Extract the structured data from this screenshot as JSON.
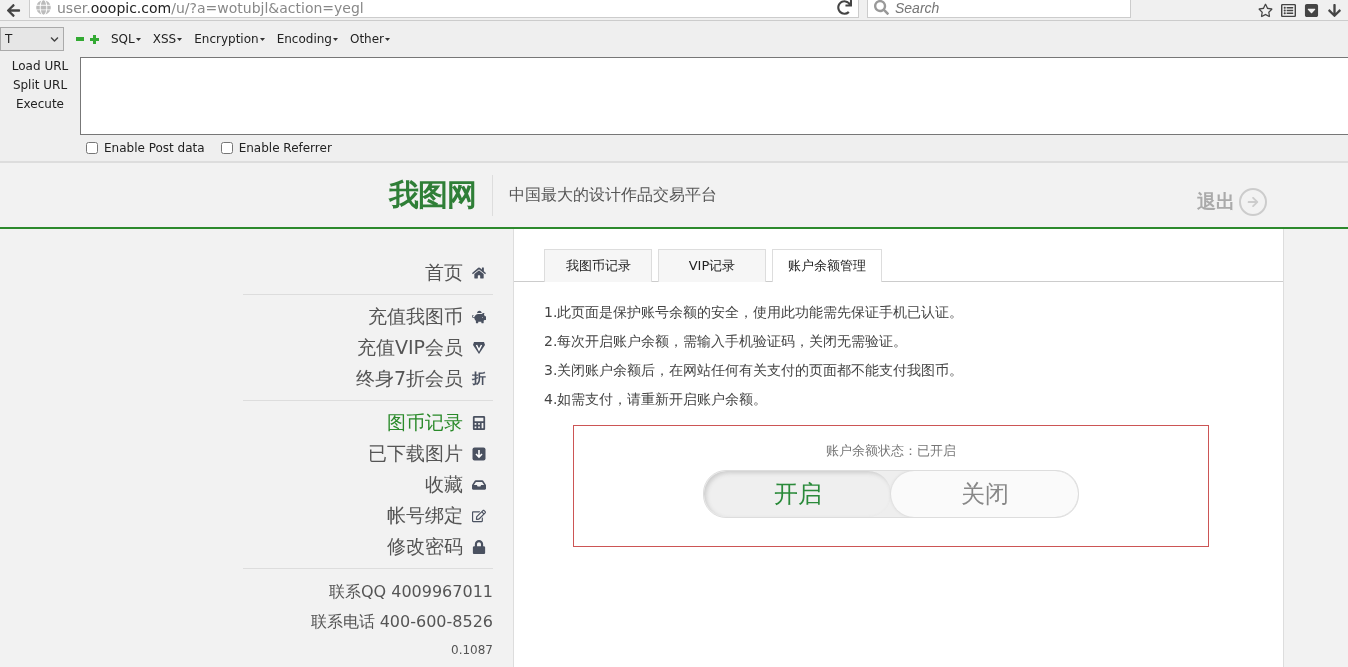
{
  "browser": {
    "url_host_prefix": "user.",
    "url_host": "ooopic.com",
    "url_path": "/u/?a=wotubjl&action=yegl",
    "search": {
      "placeholder": "Search"
    }
  },
  "hackbar": {
    "select_value": "T",
    "menus": [
      "SQL",
      "XSS",
      "Encryption",
      "Encoding",
      "Other"
    ],
    "actions": [
      "Load URL",
      "Split URL",
      "Execute"
    ],
    "options": [
      {
        "label": "Enable Post data",
        "checked": false
      },
      {
        "label": "Enable Referrer",
        "checked": false
      }
    ]
  },
  "site": {
    "logo": "我图网",
    "slogan": "中国最大的设计作品交易平台",
    "logout": "退出"
  },
  "sidebar": {
    "groups": [
      [
        {
          "label": "首页",
          "kind": "home",
          "selected": false
        }
      ],
      [
        {
          "label": "充值我图币",
          "kind": "piggy",
          "selected": false
        },
        {
          "label": "充值VIP会员",
          "kind": "vip",
          "selected": false
        },
        {
          "label": "终身7折会员",
          "kind": "text",
          "icon_text": "折",
          "selected": false
        }
      ],
      [
        {
          "label": "图币记录",
          "kind": "calculator",
          "selected": true
        },
        {
          "label": "已下载图片",
          "kind": "download",
          "selected": false
        },
        {
          "label": "收藏",
          "kind": "inbox",
          "selected": false
        },
        {
          "label": "帐号绑定",
          "kind": "edit",
          "selected": false
        },
        {
          "label": "修改密码",
          "kind": "lock",
          "selected": false
        }
      ]
    ],
    "contacts": [
      "联系QQ 4009967011",
      "联系电话 400-600-8526"
    ],
    "version": "0.1087"
  },
  "tabs": [
    {
      "label": "我图币记录",
      "selected": false
    },
    {
      "label": "VIP记录",
      "selected": false
    },
    {
      "label": "账户余额管理",
      "selected": true
    }
  ],
  "notes": [
    "1.此页面是保护账号余额的安全，使用此功能需先保证手机已认证。",
    "2.每次开启账户余额，需输入手机验证码，关闭无需验证。",
    "3.关闭账户余额后，在网站任何有关支付的页面都不能支付我图币。",
    "4.如需支付，请重新开启账户余额。"
  ],
  "balance": {
    "status": "账户余额状态：已开启",
    "options": [
      {
        "label": "开启",
        "selected": true
      },
      {
        "label": "关闭",
        "selected": false
      }
    ]
  }
}
